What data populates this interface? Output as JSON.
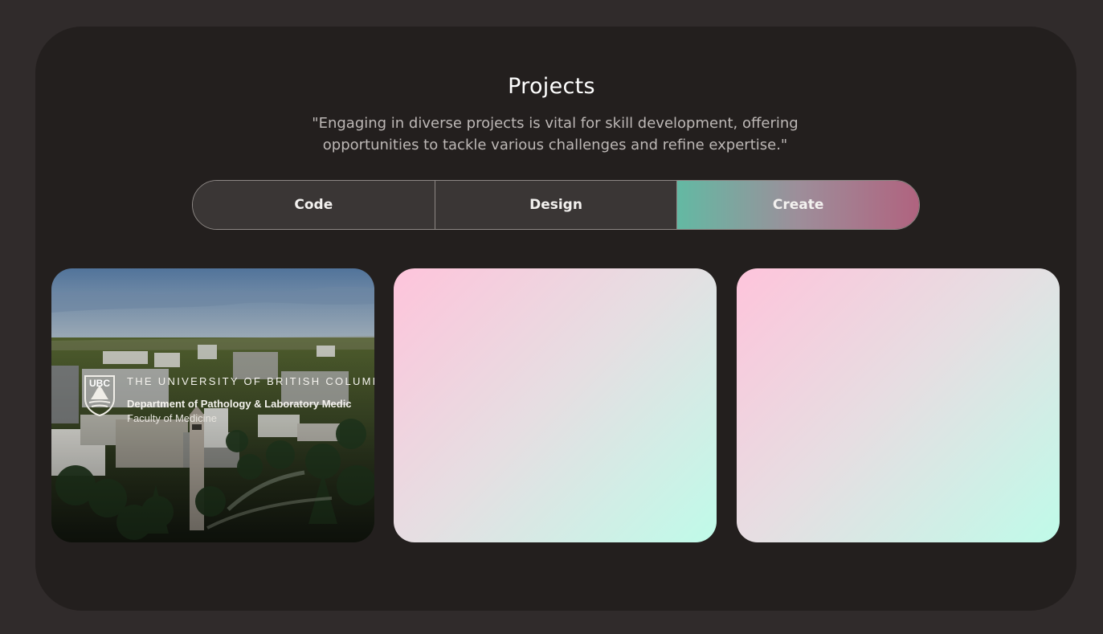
{
  "header": {
    "title": "Projects",
    "subtitle": "\"Engaging in diverse projects is vital for skill development, offering opportunities to tackle various challenges and refine expertise.\""
  },
  "tabs": [
    {
      "label": "Code",
      "active": false
    },
    {
      "label": "Design",
      "active": false
    },
    {
      "label": "Create",
      "active": true
    }
  ],
  "projects": [
    {
      "type": "image",
      "logo_badge": "UBC",
      "university": "THE UNIVERSITY OF BRITISH COLUMB",
      "department": "Department of Pathology & Laboratory Medic",
      "faculty": "Faculty of Medicine"
    },
    {
      "type": "placeholder"
    },
    {
      "type": "placeholder"
    }
  ],
  "colors": {
    "page_background": "#302b2b",
    "panel_background": "#231f1e",
    "tab_background": "#3a3635",
    "active_tab_gradient": [
      "#63b9a3",
      "#b0637f"
    ],
    "placeholder_gradient": [
      "#fec4db",
      "#bffbe9"
    ]
  }
}
